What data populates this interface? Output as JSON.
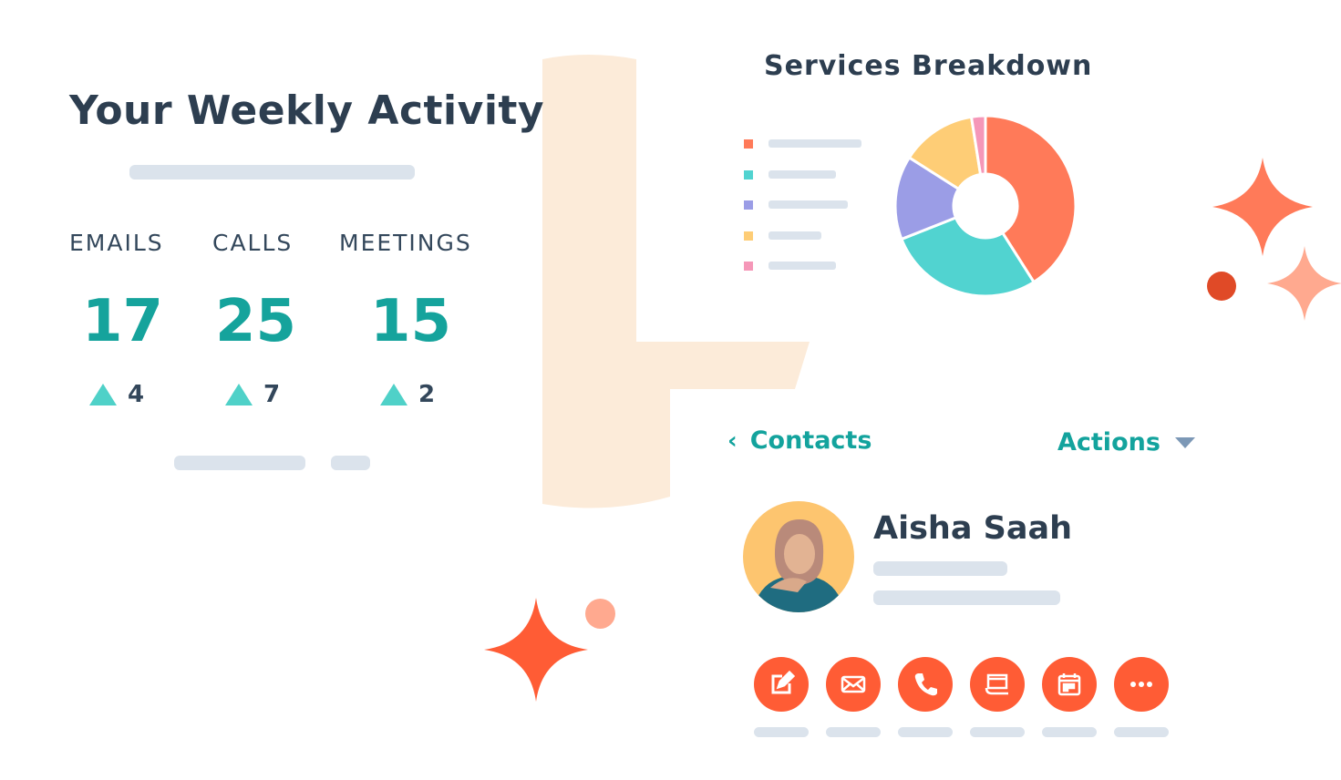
{
  "activity": {
    "title": "Your Weekly Activity",
    "stats": [
      {
        "label": "EMAILS",
        "value": "17",
        "delta": "4"
      },
      {
        "label": "CALLS",
        "value": "25",
        "delta": "7"
      },
      {
        "label": "MEETINGS",
        "value": "15",
        "delta": "2"
      }
    ],
    "delta_icon": "triangle-up-icon"
  },
  "services": {
    "title": "Services Breakdown",
    "chart_data": {
      "type": "pie",
      "donut": true,
      "values": [
        41,
        28,
        15,
        13.5,
        2.5
      ],
      "colors": [
        "#ff7a59",
        "#51d3d0",
        "#9b9de6",
        "#fecd76",
        "#f597b8"
      ]
    }
  },
  "contact": {
    "back_label": "Contacts",
    "actions_label": "Actions",
    "name": "Aisha Saah",
    "action_buttons": [
      {
        "icon": "edit-note-icon"
      },
      {
        "icon": "email-icon"
      },
      {
        "icon": "phone-icon"
      },
      {
        "icon": "task-icon"
      },
      {
        "icon": "calendar-icon"
      },
      {
        "icon": "more-icon"
      }
    ]
  },
  "colors": {
    "accent": "#ff5c35",
    "teal": "#15a39c",
    "text": "#2d3e50",
    "placeholder": "#dbe3ec",
    "beige": "#fcebd9"
  }
}
